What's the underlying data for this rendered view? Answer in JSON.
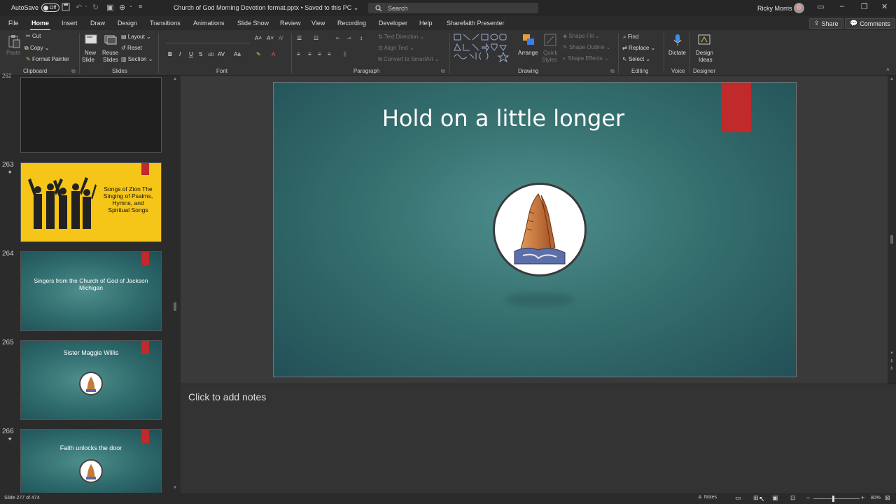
{
  "titlebar": {
    "autosave_label": "AutoSave",
    "autosave_state": "Off",
    "doc_title": "Church of God Morning Devotion format.pptx  •  Saved to this PC  ⌄",
    "search_placeholder": "Search",
    "user_name": "Ricky Morris"
  },
  "tabs": [
    "File",
    "Home",
    "Insert",
    "Draw",
    "Design",
    "Transitions",
    "Animations",
    "Slide Show",
    "Review",
    "View",
    "Recording",
    "Developer",
    "Help",
    "Sharefaith Presenter"
  ],
  "top_buttons": {
    "share": "Share",
    "comments": "Comments"
  },
  "ribbon": {
    "clipboard": {
      "paste": "Paste",
      "cut": "Cut",
      "copy": "Copy",
      "format_painter": "Format Painter",
      "label": "Clipboard"
    },
    "slides": {
      "new_slide": "New",
      "new_slide2": "Slide",
      "reuse": "Reuse",
      "reuse2": "Slides",
      "layout": "Layout",
      "reset": "Reset",
      "section": "Section",
      "label": "Slides"
    },
    "font": {
      "label": "Font"
    },
    "paragraph": {
      "text_direction": "Text Direction",
      "align_text": "Align Text",
      "convert_smartart": "Convert to SmartArt",
      "label": "Paragraph"
    },
    "drawing": {
      "arrange": "Arrange",
      "quick": "Quick",
      "styles": "Styles",
      "shape_fill": "Shape Fill",
      "shape_outline": "Shape Outline",
      "shape_effects": "Shape Effects",
      "label": "Drawing"
    },
    "editing": {
      "find": "Find",
      "replace": "Replace",
      "select": "Select",
      "label": "Editing"
    },
    "voice": {
      "dictate": "Dictate",
      "label": "Voice"
    },
    "designer": {
      "design": "Design",
      "ideas": "Ideas",
      "label": "Designer"
    }
  },
  "thumbnails": {
    "top_num": "262",
    "t263": {
      "num": "263",
      "title": "Songs of Zion The Singing of Psalms, Hymns, and Spiritual Songs"
    },
    "t264": {
      "num": "264",
      "title": "Singers from the Church of God of Jackson Michigan"
    },
    "t265": {
      "num": "265",
      "title": "Sister Maggie Willis"
    },
    "t266": {
      "num": "266",
      "title": "Faith unlocks the door"
    }
  },
  "slide": {
    "title": "Hold on a little longer"
  },
  "notes": {
    "placeholder": "Click to add notes"
  },
  "status": {
    "slide_info": "Slide 277 of 474",
    "notes_btn": "Notes",
    "zoom": "80%"
  },
  "colors": {
    "accent_red": "#c02a2a",
    "slide_teal": "#36706f",
    "thumb_yellow": "#f5c518"
  }
}
